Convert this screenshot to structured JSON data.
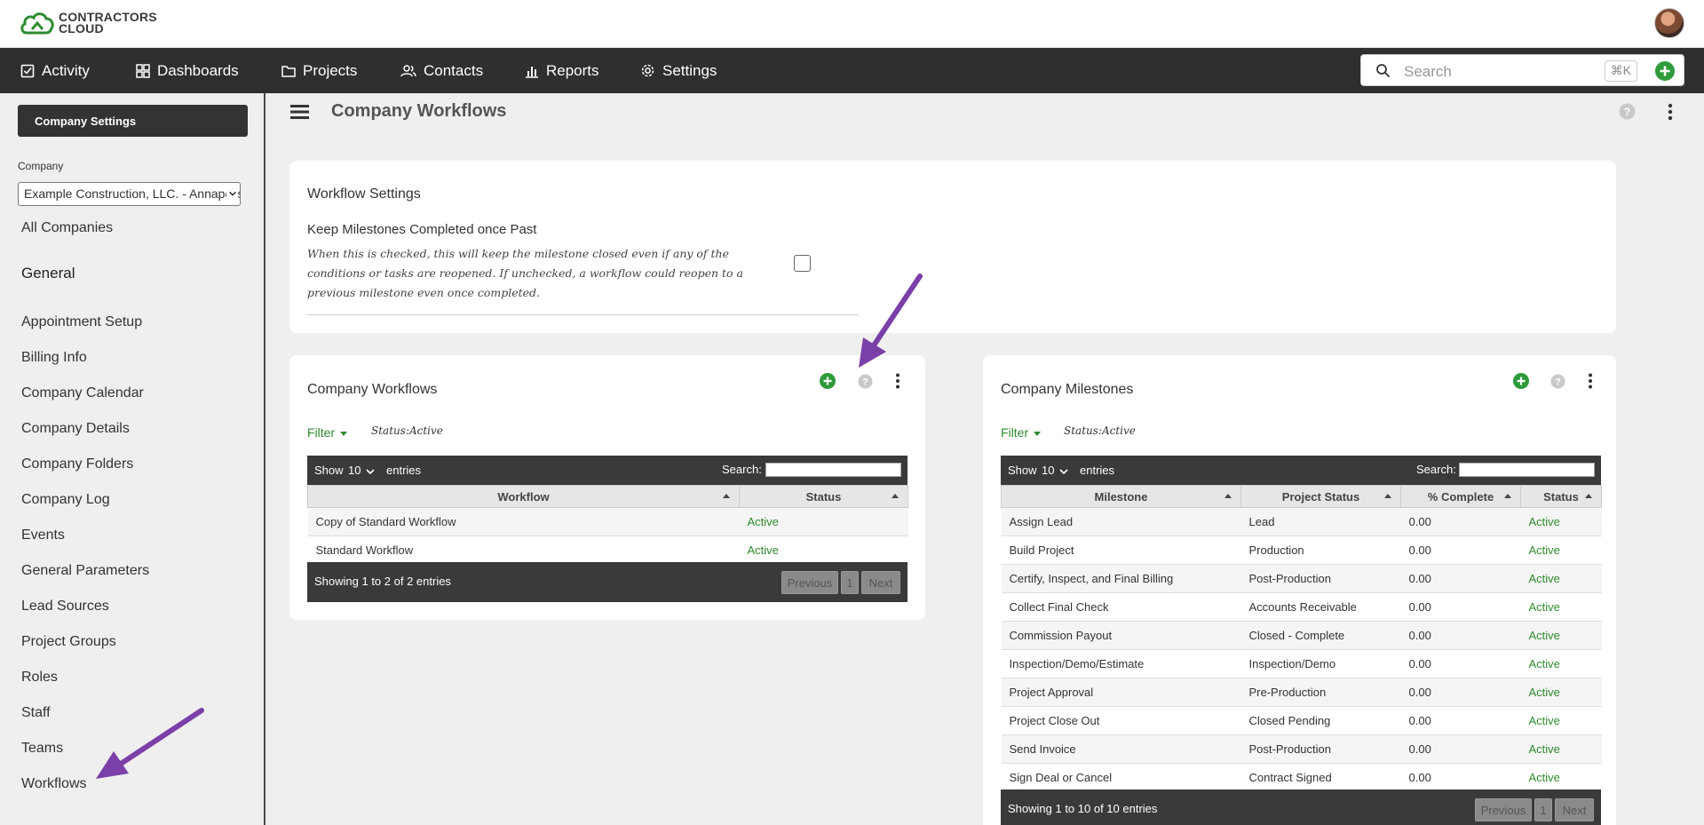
{
  "brand": {
    "line1": "CONTRACTORS",
    "line2": "CLOUD"
  },
  "nav": {
    "items": [
      "Activity",
      "Dashboards",
      "Projects",
      "Contacts",
      "Reports",
      "Settings"
    ],
    "search_placeholder": "Search",
    "shortcut": "⌘K"
  },
  "sidebar": {
    "company_settings_label": "Company Settings",
    "company_label": "Company",
    "company_value": "Example Construction, LLC. - Annapolis",
    "all_companies": "All Companies",
    "general_heading": "General",
    "links": [
      "Appointment Setup",
      "Billing Info",
      "Company Calendar",
      "Company Details",
      "Company Folders",
      "Company Log",
      "Events",
      "General Parameters",
      "Lead Sources",
      "Project Groups",
      "Roles",
      "Staff",
      "Teams",
      "Workflows"
    ]
  },
  "page": {
    "title": "Company Workflows"
  },
  "workflow_settings": {
    "title": "Workflow Settings",
    "option_label": "Keep Milestones Completed once Past",
    "option_desc": "When this is checked, this will keep the milestone closed even if any of the conditions or tasks are reopened. If unchecked, a workflow could reopen to a previous milestone even once completed.",
    "checked": false
  },
  "workflows": {
    "title": "Company Workflows",
    "filter_label": "Filter",
    "filter_status": "Status:Active",
    "show_label": "Show",
    "length": "10",
    "entries_label": "entries",
    "search_label": "Search:",
    "columns": [
      "Workflow",
      "Status"
    ],
    "rows": [
      [
        "Copy of Standard Workflow",
        "Active"
      ],
      [
        "Standard Workflow",
        "Active"
      ]
    ],
    "info": "Showing 1 to 2 of 2 entries",
    "pagination": {
      "prev": "Previous",
      "page": "1",
      "next": "Next"
    }
  },
  "milestones": {
    "title": "Company Milestones",
    "filter_label": "Filter",
    "filter_status": "Status:Active",
    "show_label": "Show",
    "length": "10",
    "entries_label": "entries",
    "search_label": "Search:",
    "columns": [
      "Milestone",
      "Project Status",
      "% Complete",
      "Status"
    ],
    "rows": [
      [
        "Assign Lead",
        "Lead",
        "0.00",
        "Active"
      ],
      [
        "Build Project",
        "Production",
        "0.00",
        "Active"
      ],
      [
        "Certify, Inspect, and Final Billing",
        "Post-Production",
        "0.00",
        "Active"
      ],
      [
        "Collect Final Check",
        "Accounts Receivable",
        "0.00",
        "Active"
      ],
      [
        "Commission Payout",
        "Closed - Complete",
        "0.00",
        "Active"
      ],
      [
        "Inspection/Demo/Estimate",
        "Inspection/Demo",
        "0.00",
        "Active"
      ],
      [
        "Project Approval",
        "Pre-Production",
        "0.00",
        "Active"
      ],
      [
        "Project Close Out",
        "Closed Pending",
        "0.00",
        "Active"
      ],
      [
        "Send Invoice",
        "Post-Production",
        "0.00",
        "Active"
      ],
      [
        "Sign Deal or Cancel",
        "Contract Signed",
        "0.00",
        "Active"
      ]
    ],
    "info": "Showing 1 to 10 of 10 entries",
    "pagination": {
      "prev": "Previous",
      "page": "1",
      "next": "Next"
    }
  },
  "colors": {
    "accent_green": "#2e8b2e",
    "nav_bg": "#2f2f2f",
    "annotation": "#7b3fa8"
  }
}
